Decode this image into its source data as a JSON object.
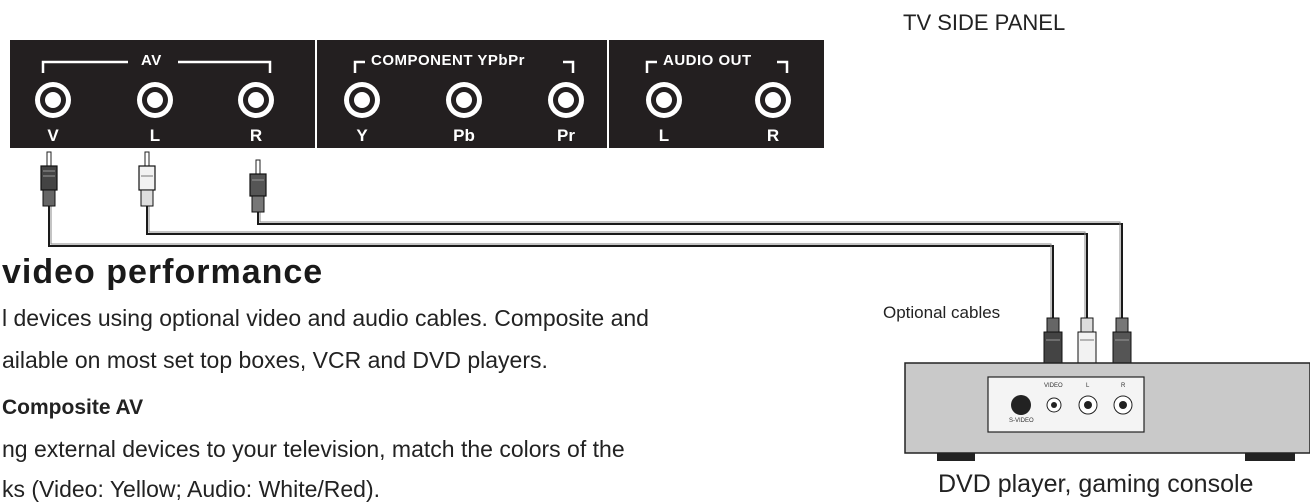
{
  "panel": {
    "title": "TV SIDE PANEL",
    "groups": [
      {
        "label": "AV",
        "ports": [
          "V",
          "L",
          "R"
        ]
      },
      {
        "label": "COMPONENT YPbPr",
        "ports": [
          "Y",
          "Pb",
          "Pr"
        ]
      },
      {
        "label": "AUDIO OUT",
        "ports": [
          "L",
          "R"
        ]
      }
    ]
  },
  "heading": "video performance",
  "paragraph1": [
    "l devices using optional video and audio cables. Composite and",
    "ailable on most set top boxes, VCR and DVD players."
  ],
  "subheading": "Composite AV",
  "paragraph2": [
    "ng external devices to your television, match the colors of the",
    "ks (Video: Yellow; Audio: White/Red)."
  ],
  "cables_label": "Optional cables",
  "device": {
    "label": "DVD player, gaming console",
    "jack_labels": [
      "VIDEO",
      "L",
      "R",
      "S-VIDEO"
    ]
  }
}
